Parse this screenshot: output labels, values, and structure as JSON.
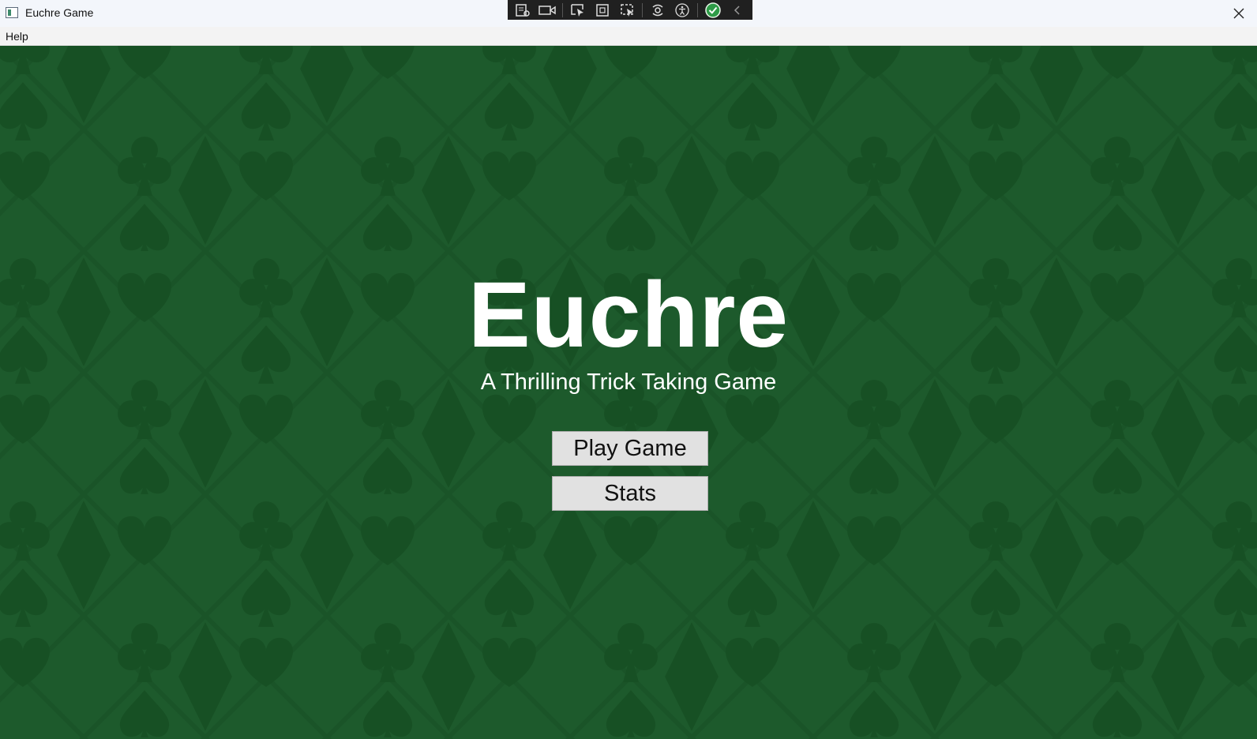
{
  "window": {
    "title": "Euchre Game"
  },
  "menu": {
    "items": [
      {
        "label": "Help"
      }
    ]
  },
  "debug_toolbar": {
    "icons": [
      "live-visual-tree-icon",
      "video-camera-icon",
      "select-element-icon",
      "display-layout-adorners-icon",
      "track-focus-icon",
      "binding-failures-icon",
      "accessibility-icon",
      "hot-reload-check-icon",
      "collapse-chevron-icon"
    ]
  },
  "main": {
    "title": "Euchre",
    "subtitle": "A Thrilling Trick Taking Game",
    "buttons": {
      "play": "Play Game",
      "stats": "Stats"
    }
  },
  "colors": {
    "felt": "#1d5a2c",
    "suit_shape": "#175024",
    "button_bg": "#e1e1e1",
    "title_text": "#ffffff"
  }
}
